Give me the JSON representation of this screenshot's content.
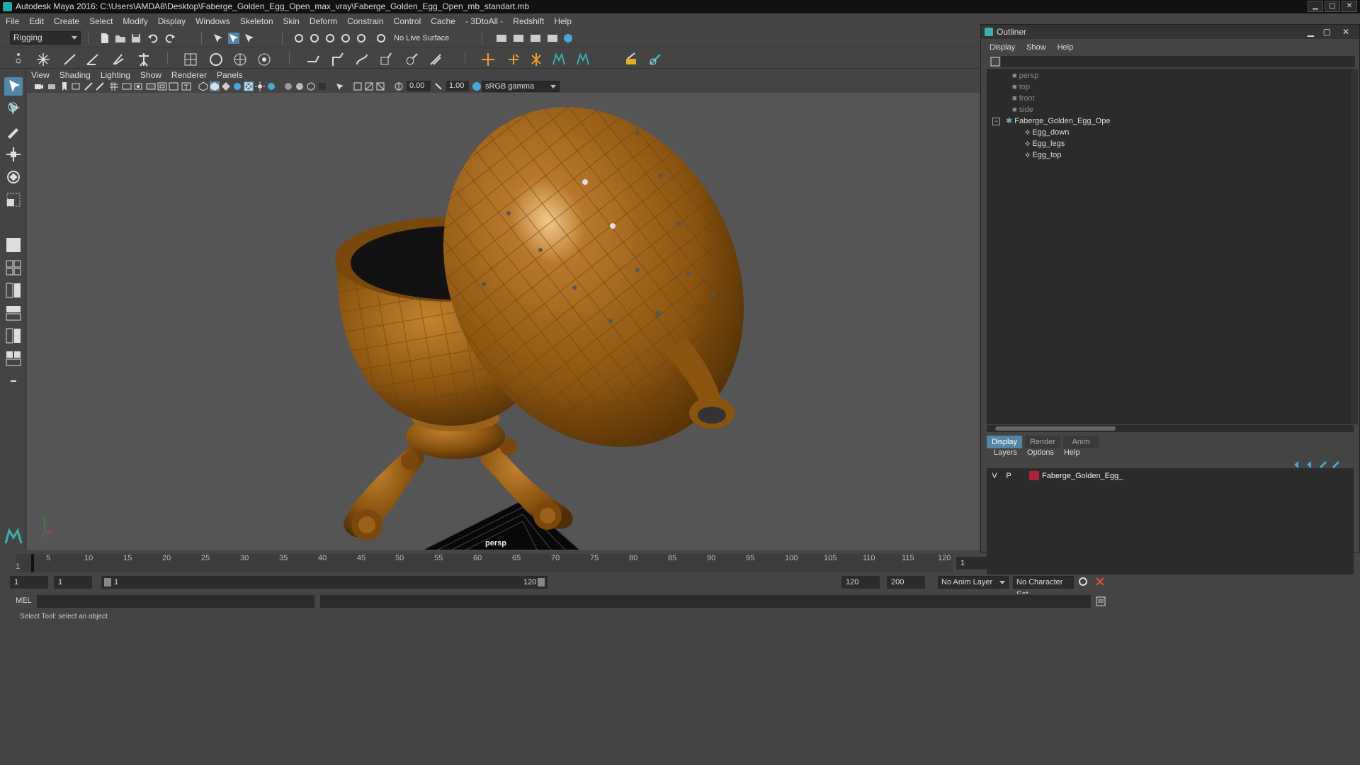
{
  "window": {
    "title": "Autodesk Maya 2016: C:\\Users\\AMDA8\\Desktop\\Faberge_Golden_Egg_Open_max_vray\\Faberge_Golden_Egg_Open_mb_standart.mb",
    "min": "▁",
    "max": "▢",
    "close": "✕"
  },
  "menus": [
    "File",
    "Edit",
    "Create",
    "Select",
    "Modify",
    "Display",
    "Windows",
    "Skeleton",
    "Skin",
    "Deform",
    "Constrain",
    "Control",
    "Cache",
    "- 3DtoAll -",
    "Redshift",
    "Help"
  ],
  "shelf": {
    "mode": "Rigging",
    "live_surface": "No Live Surface"
  },
  "viewport": {
    "menus": [
      "View",
      "Shading",
      "Lighting",
      "Show",
      "Renderer",
      "Panels"
    ],
    "exposure": "0.00",
    "gamma": "1.00",
    "color_space": "sRGB gamma",
    "camera_label": "persp"
  },
  "timeline": {
    "ticks": [
      "5",
      "10",
      "15",
      "20",
      "25",
      "30",
      "35",
      "40",
      "45",
      "50",
      "55",
      "60",
      "65",
      "70",
      "75",
      "80",
      "85",
      "90",
      "95",
      "100",
      "105",
      "110",
      "115",
      "120"
    ],
    "start_mark": "1",
    "current_frame": "1"
  },
  "range": {
    "start": "1",
    "anim_start": "1",
    "slider_start": "1",
    "slider_end": "120",
    "end": "120",
    "anim_end": "200",
    "anim_layer": "No Anim Layer",
    "character_set": "No Character Set"
  },
  "cmd": {
    "label": "MEL"
  },
  "help_line": "Select Tool: select an object",
  "outliner": {
    "title": "Outliner",
    "menus": [
      "Display",
      "Show",
      "Help"
    ],
    "cameras": [
      "persp",
      "top",
      "front",
      "side"
    ],
    "group": "Faberge_Golden_Egg_Ope",
    "children": [
      "Egg_down",
      "Egg_legs",
      "Egg_top"
    ]
  },
  "layers": {
    "tabs": [
      "Display",
      "Render",
      "Anim"
    ],
    "menus": [
      "Layers",
      "Options",
      "Help"
    ],
    "row": {
      "v": "V",
      "p": "P",
      "name": "Faberge_Golden_Egg_",
      "color": "#b0203c"
    }
  }
}
